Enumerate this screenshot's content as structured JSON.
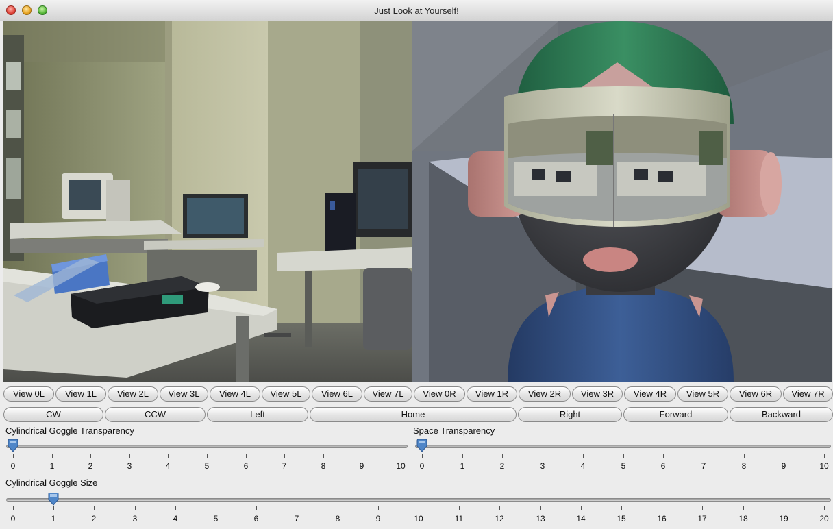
{
  "window": {
    "title": "Just Look at Yourself!"
  },
  "view_buttons": [
    "View 0L",
    "View 1L",
    "View 2L",
    "View 3L",
    "View 4L",
    "View 5L",
    "View 6L",
    "View 7L",
    "View 0R",
    "View 1R",
    "View 2R",
    "View 3R",
    "View 4R",
    "View 5R",
    "View 6R",
    "View 7R"
  ],
  "nav_buttons": [
    "CW",
    "CCW",
    "Left",
    "Home",
    "Right",
    "Forward",
    "Backward"
  ],
  "sliders": {
    "goggle_transparency": {
      "label": "Cylindrical Goggle Transparency",
      "min": 0,
      "max": 10,
      "value": 0,
      "ticks": [
        "0",
        "1",
        "2",
        "3",
        "4",
        "5",
        "6",
        "7",
        "8",
        "9",
        "10"
      ]
    },
    "space_transparency": {
      "label": "Space Transparency",
      "min": 0,
      "max": 10,
      "value": 0,
      "ticks": [
        "0",
        "1",
        "2",
        "3",
        "4",
        "5",
        "6",
        "7",
        "8",
        "9",
        "10"
      ]
    },
    "goggle_size": {
      "label": "Cylindrical Goggle Size",
      "min": 0,
      "max": 20,
      "value": 1,
      "ticks": [
        "0",
        "1",
        "2",
        "3",
        "4",
        "5",
        "6",
        "7",
        "8",
        "9",
        "10",
        "11",
        "12",
        "13",
        "14",
        "15",
        "16",
        "17",
        "18",
        "19",
        "20"
      ]
    }
  },
  "colors": {
    "thumb": "#4f86c8",
    "avatar_hat": "#2e7a55",
    "avatar_skin": "#c08a86",
    "avatar_shirt": "#2f4a7a"
  }
}
